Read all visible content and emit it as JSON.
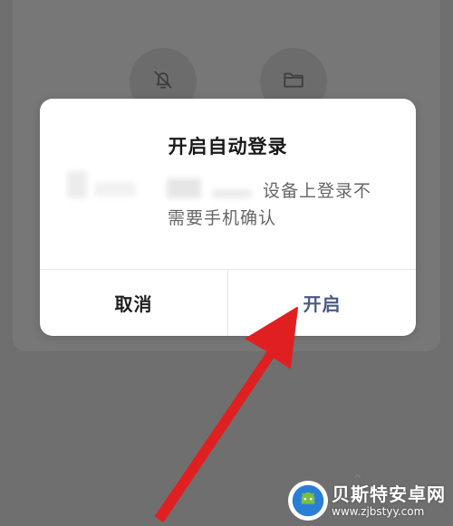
{
  "background": {
    "icons": [
      "bell-off-icon",
      "folder-icon"
    ]
  },
  "dialog": {
    "title": "开启自动登录",
    "message_line1": "设备上登录不",
    "message_line2": "需要手机确认",
    "cancel_label": "取消",
    "confirm_label": "开启"
  },
  "watermark": {
    "name": "贝斯特安卓网",
    "url": "www.zjbstyy.com"
  },
  "colors": {
    "overlay": "#6f6f6f",
    "dialog_bg": "#ffffff",
    "confirm_text": "#4a5a86",
    "arrow": "#e02020"
  }
}
